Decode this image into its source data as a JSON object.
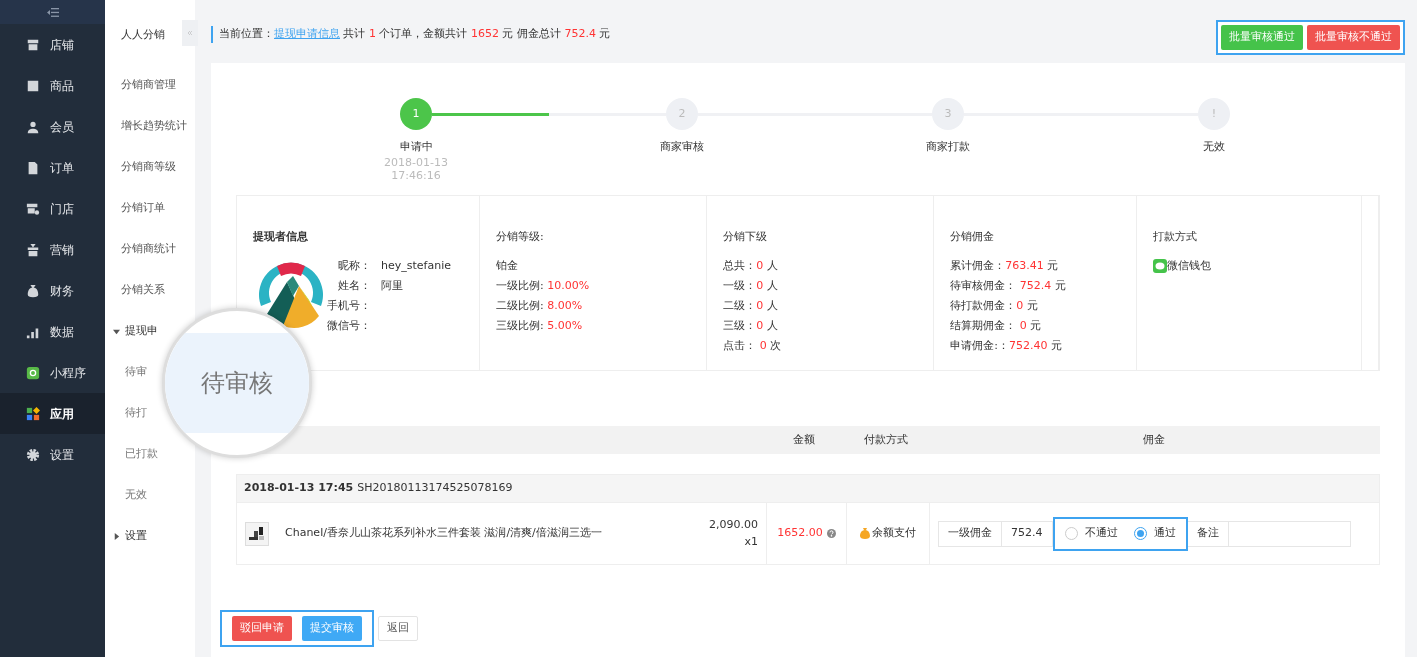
{
  "sidebar": {
    "items": [
      {
        "label": "店铺",
        "selected": false
      },
      {
        "label": "商品",
        "selected": false
      },
      {
        "label": "会员",
        "selected": false
      },
      {
        "label": "订单",
        "selected": false
      },
      {
        "label": "门店",
        "selected": false
      },
      {
        "label": "营销",
        "selected": false
      },
      {
        "label": "财务",
        "selected": false
      },
      {
        "label": "数据",
        "selected": false
      },
      {
        "label": "小程序",
        "selected": false
      },
      {
        "label": "应用",
        "selected": true
      },
      {
        "label": "设置",
        "selected": false
      }
    ]
  },
  "subnav": {
    "title": "人人分销",
    "items": [
      {
        "label": "分销商管理",
        "kind": "link"
      },
      {
        "label": "增长趋势统计",
        "kind": "link"
      },
      {
        "label": "分销商等级",
        "kind": "link"
      },
      {
        "label": "分销订单",
        "kind": "link"
      },
      {
        "label": "分销商统计",
        "kind": "link"
      },
      {
        "label": "分销关系",
        "kind": "link"
      },
      {
        "label": "提现申",
        "kind": "group",
        "expanded": true,
        "children": [
          {
            "label": "待审"
          },
          {
            "label": "待打"
          },
          {
            "label": "已打款"
          },
          {
            "label": "无效"
          }
        ]
      },
      {
        "label": "设置",
        "kind": "group",
        "expanded": false
      }
    ]
  },
  "magnifier": {
    "text": "待审核"
  },
  "breadcrumb": [
    {
      "text": "当前位置：",
      "kind": "plain"
    },
    {
      "text": "提现申请信息",
      "kind": "link"
    },
    {
      "text": " 共计 ",
      "kind": "plain"
    },
    {
      "text": "1",
      "kind": "num"
    },
    {
      "text": " 个订单，金额共计 ",
      "kind": "plain"
    },
    {
      "text": "1652",
      "kind": "num"
    },
    {
      "text": " 元 佣金总计 ",
      "kind": "plain"
    },
    {
      "text": "752.4",
      "kind": "num"
    },
    {
      "text": " 元",
      "kind": "plain"
    }
  ],
  "top_buttons": [
    {
      "label": "批量审核通过",
      "kind": "success"
    },
    {
      "label": "批量审核不通过",
      "kind": "danger"
    }
  ],
  "steps": [
    {
      "number": "1",
      "label": "申请中",
      "date": "2018-01-13",
      "time": "17:46:16",
      "done": true
    },
    {
      "number": "2",
      "label": "商家审核",
      "done": false
    },
    {
      "number": "3",
      "label": "商家打款",
      "done": false
    },
    {
      "number": "!",
      "label": "无效",
      "done": false
    }
  ],
  "applicant": {
    "title": "提现者信息",
    "fields": [
      {
        "label": "昵称：",
        "value": "hey_stefanie"
      },
      {
        "label": "姓名：",
        "value": "阿里"
      },
      {
        "label": "手机号："
      },
      {
        "label": "微信号："
      }
    ]
  },
  "level_info": {
    "title": "分销等级:",
    "level": "铂金",
    "rows": [
      {
        "label": "一级比例: ",
        "value": "10.00%"
      },
      {
        "label": "二级比例: ",
        "value": "8.00%"
      },
      {
        "label": "三级比例: ",
        "value": "5.00%"
      }
    ]
  },
  "downline": {
    "title": "分销下级",
    "rows": [
      {
        "label": "总共：",
        "value": "0",
        "unit": " 人"
      },
      {
        "label": "一级：",
        "value": "0",
        "unit": " 人"
      },
      {
        "label": "二级：",
        "value": "0",
        "unit": " 人"
      },
      {
        "label": "三级：",
        "value": "0",
        "unit": " 人"
      },
      {
        "label": "点击： ",
        "value": "0",
        "unit": " 次"
      }
    ]
  },
  "commission": {
    "title": "分销佣金",
    "rows": [
      {
        "label": "累计佣金：",
        "value": "763.41",
        "unit": " 元"
      },
      {
        "label": "待审核佣金： ",
        "value": "752.4",
        "unit": " 元"
      },
      {
        "label": "待打款佣金：",
        "value": "0",
        "unit": " 元"
      },
      {
        "label": "结算期佣金： ",
        "value": "0",
        "unit": " 元"
      },
      {
        "label": "申请佣金:：",
        "value": "752.40",
        "unit": " 元"
      }
    ]
  },
  "payout": {
    "title": "打款方式",
    "method": "微信钱包"
  },
  "table": {
    "columns": [
      "金额",
      "付款方式",
      "佣金"
    ]
  },
  "order": {
    "datetime": "2018-01-13 17:45",
    "number": "SH20180113174525078169",
    "product": {
      "name": "Chanel/香奈儿山茶花系列补水三件套装 滋润/清爽/倍滋润三选一",
      "price": "2,090.00",
      "quantity": "x1",
      "amount": "1652.00",
      "payment": "余额支付",
      "commission_label": "一级佣金",
      "commission_value": "752.4",
      "options": [
        {
          "label": "不通过",
          "selected": false
        },
        {
          "label": "通过",
          "selected": true
        }
      ],
      "remark_label": "备注"
    }
  },
  "bottom_buttons": [
    {
      "label": "驳回申请",
      "kind": "danger"
    },
    {
      "label": "提交审核",
      "kind": "primary"
    },
    {
      "label": "返回",
      "kind": "plain"
    }
  ]
}
